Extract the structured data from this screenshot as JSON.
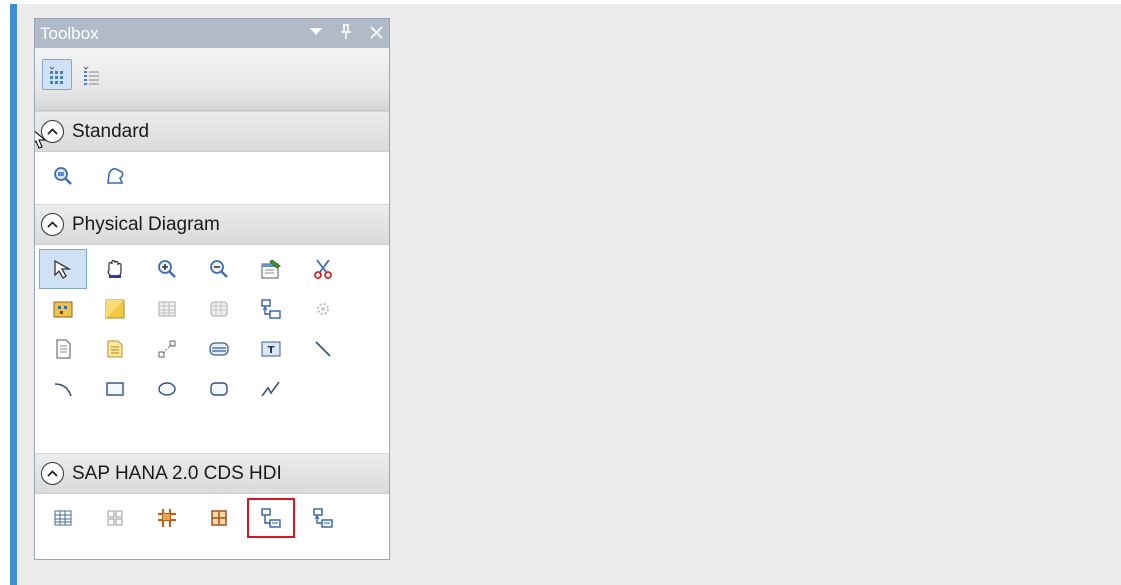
{
  "toolbox": {
    "title": "Toolbox",
    "controls": [
      "dropdown-icon",
      "pin-icon",
      "close-icon"
    ],
    "view_buttons": [
      "icon-view-icon",
      "list-view-icon"
    ]
  },
  "sections": {
    "standard": {
      "label": "Standard",
      "items": [
        "zoom-icon",
        "lasso-icon"
      ]
    },
    "physical": {
      "label": "Physical Diagram",
      "items": [
        "pointer-icon",
        "hand-icon",
        "zoom-in-icon",
        "zoom-out-icon",
        "properties-icon",
        "cut-icon",
        "package-icon",
        "area-icon",
        "table-icon",
        "view-icon",
        "reference-icon",
        "procedure-icon",
        "file-icon",
        "note-icon",
        "link-icon",
        "storage-icon",
        "text-icon",
        "line-icon",
        "arc-icon",
        "rectangle-icon",
        "ellipse-icon",
        "rounded-rectangle-icon",
        "polyline-icon"
      ]
    },
    "hana": {
      "label": "SAP HANA 2.0 CDS HDI",
      "items": [
        "table-icon",
        "table-type-icon",
        "entity-icon",
        "structure-icon",
        "association-icon",
        "reference-icon"
      ]
    }
  },
  "colors": {
    "accent": "#3d8fd1",
    "title_bar": "#b1bbc8",
    "highlight": "#e0141e",
    "selection": "#cfe1f4"
  }
}
